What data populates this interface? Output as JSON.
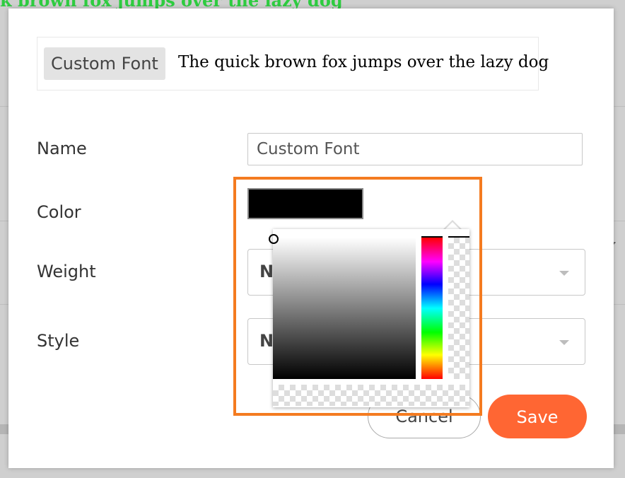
{
  "background": {
    "sample_text": "k brown fox jumps over the lazy dog",
    "right_fragment": "y"
  },
  "dialog": {
    "preview": {
      "tag": "Custom Font",
      "sample": "The quick brown fox jumps over the lazy dog"
    },
    "fields": {
      "name_label": "Name",
      "name_value": "Custom Font",
      "color_label": "Color",
      "color_value": "#000000",
      "weight_label": "Weight",
      "weight_value": "N",
      "style_label": "Style",
      "style_value": "N"
    },
    "buttons": {
      "cancel": "Cancel",
      "save": "Save"
    }
  },
  "colors": {
    "highlight": "#f47b20",
    "save": "#ff6633",
    "bg_sample": "#2ecc40"
  },
  "color_picker": {
    "hue_position": 0,
    "alpha_position": 0
  }
}
